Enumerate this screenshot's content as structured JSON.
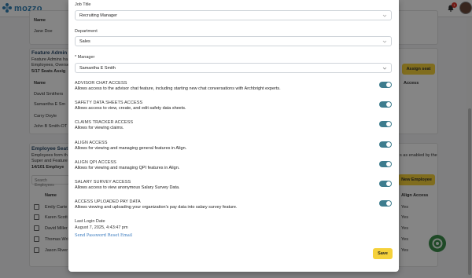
{
  "app": {
    "logo_text": "mozzo",
    "notification_count": "1"
  },
  "background": {
    "users_table": {
      "header_name": "Name",
      "row1": "Jane Doe"
    },
    "feature_admins": {
      "title": "Feature Admin",
      "desc1": "Feature Admins ha",
      "desc2": "Employees, Overse",
      "seats": "5/17 Seats Assig",
      "assign_button": "Assign seat",
      "header_name": "Name",
      "header_access": "Access",
      "rows": [
        "David Smithers",
        "Samantha E Sm",
        "Carry Doyle",
        "John B Smith-OT"
      ]
    },
    "employee_seats": {
      "title": "Employee Seat",
      "desc1": "Employees form th",
      "desc2": "Super and Feature",
      "seats": "14/101 Employe",
      "side_note": "s as enabled by the",
      "search_placeholder": "Search Employees",
      "new_button": "New Employee",
      "header_name": "Name",
      "header_align": "Align Access",
      "rows": [
        {
          "name": "Emily Carte",
          "access": "Yes"
        },
        {
          "name": "Karen Scott",
          "access": "Yes"
        },
        {
          "name": "David Miller",
          "access": "Yes"
        },
        {
          "name": "Thomas Wri",
          "access": "Yes"
        },
        {
          "name": "Jason River",
          "access": "Yes"
        }
      ]
    }
  },
  "modal": {
    "job_title": {
      "label": "Job Title",
      "value": "Recruiting Manager"
    },
    "department": {
      "label": "Department",
      "value": "Sales"
    },
    "manager": {
      "label": "* Manager",
      "value": "Samantha E Smith"
    },
    "permissions": [
      {
        "title": "ADVISOR CHAT ACCESS",
        "desc": "Allows access to the advisor chat feature, including starting new chat conversations with Archbright experts.",
        "enabled": true
      },
      {
        "title": "SAFETY DATA SHEETS ACCESS",
        "desc": "Allows access to view, create, and edit safety data sheets.",
        "enabled": true
      },
      {
        "title": "CLAIMS TRACKER ACCESS",
        "desc": "Allows for viewing claims.",
        "enabled": true
      },
      {
        "title": "ALIGN ACCESS",
        "desc": "Allows for viewing and managing general features in Align.",
        "enabled": true
      },
      {
        "title": "ALIGN QPI ACCESS",
        "desc": "Allows for viewing and managing QPI features in Align.",
        "enabled": true
      },
      {
        "title": "SALARY SURVEY ACCESS",
        "desc": "Allows access to view anonymous Salary Survey Data.",
        "enabled": true
      },
      {
        "title": "ACCESS UPLOADED PAY DATA",
        "desc": "Allows viewing and uploading your organization's pay data into salary survey feature.",
        "enabled": true
      }
    ],
    "last_login_label": "Last Login Date",
    "last_login_value": "August 7, 2025, 4:43:47 pm",
    "reset_link": "Send Password Reset Email",
    "save_label": "Save"
  },
  "colors": {
    "accent_yellow": "#f5d13b",
    "toggle_on": "#3d7c8e",
    "link": "#3a7bbf",
    "brand_blue": "#2f7fb5"
  }
}
